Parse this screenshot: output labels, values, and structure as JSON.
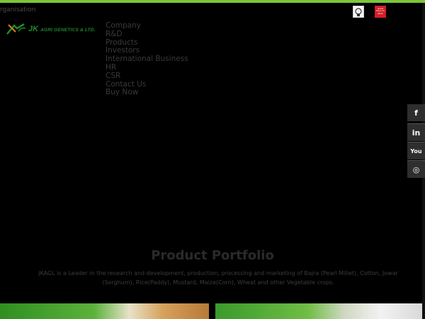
{
  "header": {
    "org_label": "rganisation",
    "logo": {
      "brand": "JK",
      "name": "AGRI GENETICS & LTD."
    },
    "badges": [
      {
        "name": "certification-badge"
      },
      {
        "name": "great-place-to-work-badge",
        "text": "Great Place To Work"
      }
    ]
  },
  "nav": {
    "items": [
      "Company",
      "R&D",
      "Products",
      "Investors",
      "International Business",
      "HR",
      "CSR",
      "Contact Us",
      "Buy Now"
    ]
  },
  "social": {
    "items": [
      {
        "icon": "facebook-icon",
        "glyph": "f"
      },
      {
        "icon": "linkedin-icon",
        "glyph": "in"
      },
      {
        "icon": "youtube-icon",
        "glyph": "You"
      },
      {
        "icon": "instagram-icon",
        "glyph": "◎"
      }
    ]
  },
  "portfolio": {
    "title": "Product Portfolio",
    "description": "JKAGL is a Leader in the research and development, production, processing and marketing of Bajra (Pearl Millet), Cotton, Jowar (Sorghum), Rice(Paddy), Mustard, Maize(Corn), Wheat and other Vegetable crops."
  },
  "colors": {
    "accent": "#7cc63a",
    "brand_green": "#1f8a2a",
    "badge_red": "#d11f26"
  }
}
